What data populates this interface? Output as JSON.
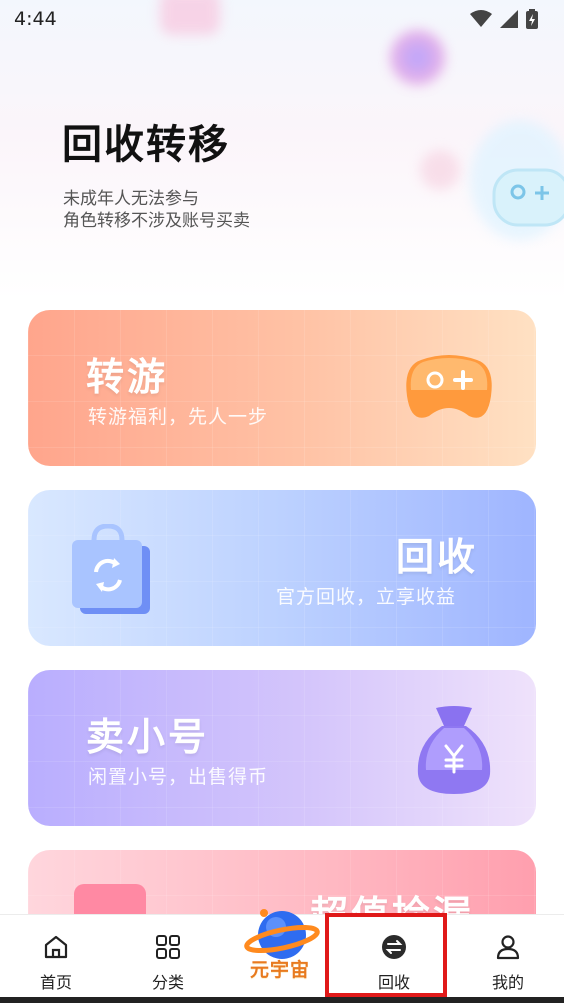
{
  "status_bar": {
    "time": "4:44",
    "icons": [
      "wifi-icon",
      "signal-icon",
      "battery-charging-icon"
    ]
  },
  "hero": {
    "title": "回收转移",
    "subtitle_line1": "未成年人无法参与",
    "subtitle_line2": "角色转移不涉及账号买卖"
  },
  "cards": [
    {
      "title": "转游",
      "subtitle": "转游福利，先人一步",
      "icon": "gamepad-icon"
    },
    {
      "title": "回收",
      "subtitle": "官方回收，立享收益",
      "icon": "recycle-bag-icon"
    },
    {
      "title": "卖小号",
      "subtitle": "闲置小号，出售得币",
      "icon": "money-bag-icon"
    },
    {
      "title": "超值捡漏",
      "subtitle": "",
      "icon": "gift-box-icon"
    }
  ],
  "tabbar": {
    "items": [
      {
        "label": "首页",
        "icon": "home-icon"
      },
      {
        "label": "分类",
        "icon": "grid-icon"
      },
      {
        "label": "元宇宙",
        "icon": "planet-icon"
      },
      {
        "label": "回收",
        "icon": "exchange-icon",
        "active": true
      },
      {
        "label": "我的",
        "icon": "user-icon"
      }
    ]
  },
  "colors": {
    "highlight": "#e01919",
    "card1": "#ffa58c",
    "card2": "#9fb5ff",
    "card3": "#b9aefe",
    "card4": "#ffb8c2"
  }
}
